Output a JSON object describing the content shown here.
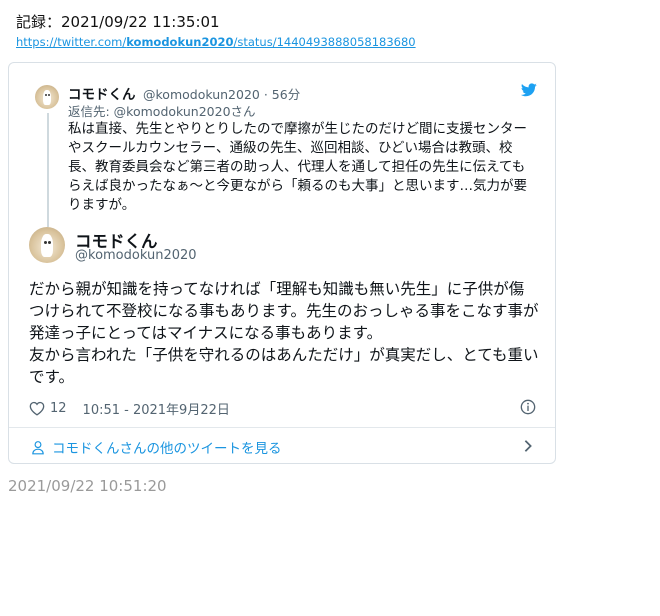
{
  "header": {
    "record_label": "記録：2021/09/22 11:35:01",
    "url_prefix": "https://twitter.com/",
    "url_user": "komodokun2020",
    "url_suffix": "/status/1440493888058183680"
  },
  "parent_tweet": {
    "name": "コモドくん",
    "handle": "@komodokun2020",
    "time": "· 56分",
    "reply_to": "返信先: @komodokun2020さん",
    "text": "私は直接、先生とやりとりしたので摩擦が生じたのだけど間に支援センターやスクールカウンセラー、通級の先生、巡回相談、ひどい場合は教頭、校長、教育委員会など第三者の助っ人、代理人を通して担任の先生に伝えてもらえば良かったなぁ〜と今更ながら「頼るのも大事」と思います…気力が要りますが。"
  },
  "main_tweet": {
    "name": "コモドくん",
    "handle": "@komodokun2020",
    "text": "だから親が知識を持ってなければ「理解も知識も無い先生」に子供が傷つけられて不登校になる事もあります。先生のおっしゃる事をこなす事が発達っ子にとってはマイナスになる事もあります。\n友から言われた「子供を守れるのはあんただけ」が真実だし、とても重いです。",
    "likes": "12",
    "timestamp": "10:51 - 2021年9月22日"
  },
  "footer": {
    "more_tweets": "コモドくんさんの他のツイートを見る"
  },
  "capture_time": "2021/09/22 10:51:20",
  "colors": {
    "link": "#1b95e0",
    "secondary": "#536471",
    "border": "#d9e0e6"
  },
  "icons": [
    "twitter-bird-icon",
    "heart-icon",
    "info-icon",
    "person-icon",
    "chevron-right-icon"
  ]
}
